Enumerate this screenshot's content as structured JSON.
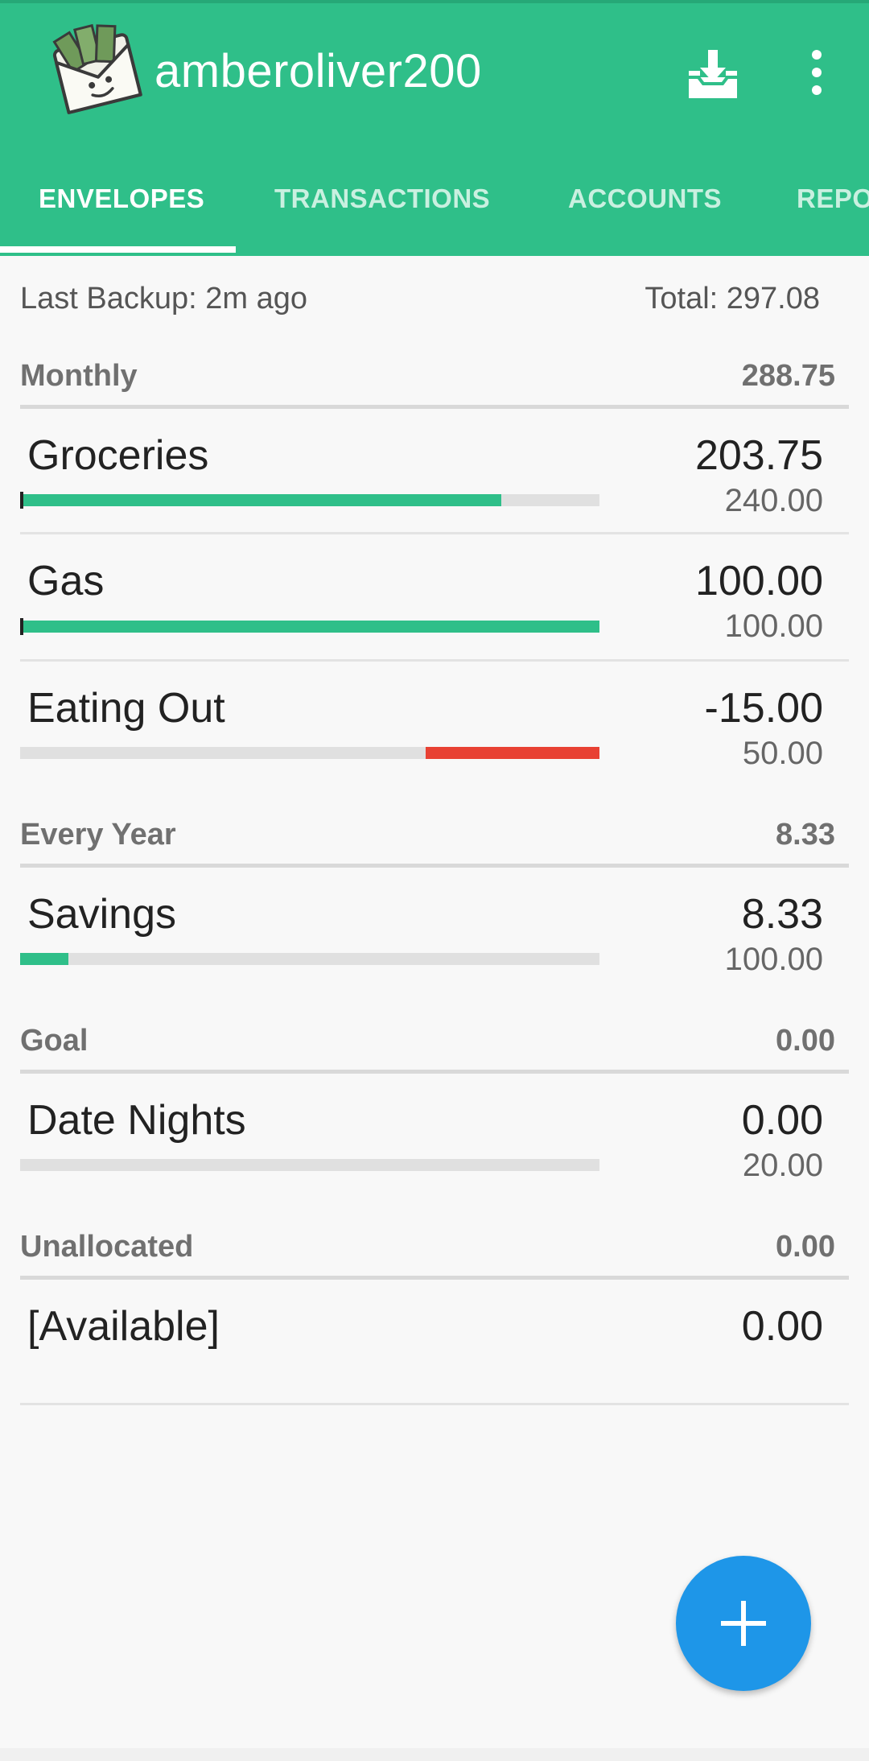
{
  "app": {
    "title": "amberoliver200"
  },
  "tabs": [
    {
      "label": "ENVELOPES",
      "active": true
    },
    {
      "label": "TRANSACTIONS",
      "active": false
    },
    {
      "label": "ACCOUNTS",
      "active": false
    },
    {
      "label": "REPO",
      "active": false
    }
  ],
  "summary": {
    "backup": "Last Backup: 2m ago",
    "total": "Total: 297.08"
  },
  "sections": [
    {
      "name": "Monthly",
      "amount": "288.75",
      "envelopes": [
        {
          "label": "Groceries",
          "amount": "203.75",
          "budget": "240.00",
          "fill_fraction": 0.83,
          "fill_color": "#2fbf89",
          "direction": "left"
        },
        {
          "label": "Gas",
          "amount": "100.00",
          "budget": "100.00",
          "fill_fraction": 1.0,
          "fill_color": "#2fbf89",
          "direction": "left"
        },
        {
          "label": "Eating Out",
          "amount": "-15.00",
          "budget": "50.00",
          "fill_fraction": 0.3,
          "fill_color": "#e84133",
          "direction": "right"
        }
      ]
    },
    {
      "name": "Every Year",
      "amount": "8.33",
      "envelopes": [
        {
          "label": "Savings",
          "amount": "8.33",
          "budget": "100.00",
          "fill_fraction": 0.0833,
          "fill_color": "#2fbf89",
          "direction": "left"
        }
      ]
    },
    {
      "name": "Goal",
      "amount": "0.00",
      "envelopes": [
        {
          "label": "Date Nights",
          "amount": "0.00",
          "budget": "20.00",
          "fill_fraction": 0.0,
          "fill_color": "#2fbf89",
          "direction": "left"
        }
      ]
    },
    {
      "name": "Unallocated",
      "amount": "0.00",
      "envelopes": [
        {
          "label": "[Available]",
          "amount": "0.00"
        }
      ]
    }
  ],
  "colors": {
    "accent": "#2fbf89",
    "negative": "#e84133",
    "fab": "#1e96e8"
  },
  "icons": {
    "download": "download-icon",
    "more": "more-vert-icon",
    "add": "plus-icon",
    "logo": "envelope-logo-icon"
  }
}
